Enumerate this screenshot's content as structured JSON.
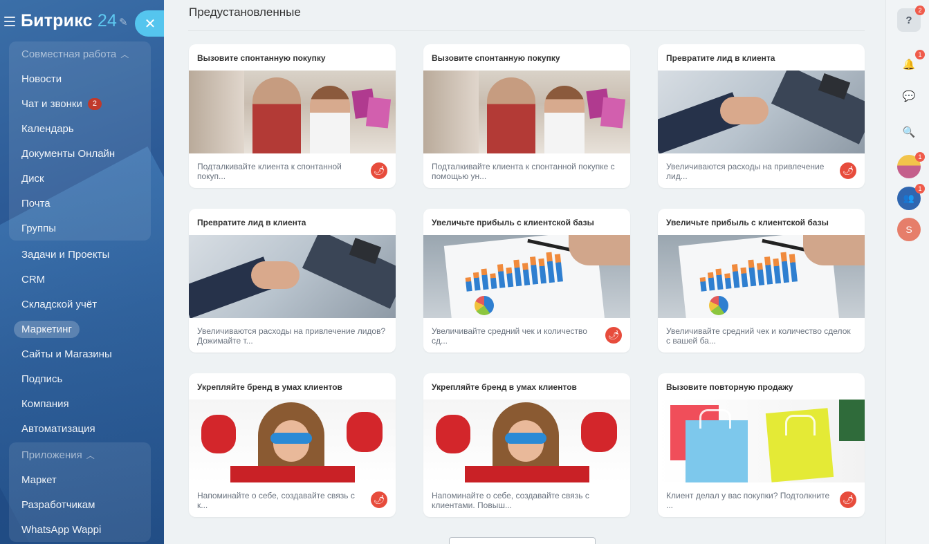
{
  "sidebar": {
    "logo_text": "Битрикс",
    "logo_num": "24",
    "groups": [
      {
        "title": "Совместная работа",
        "items": [
          {
            "label": "Новости"
          },
          {
            "label": "Чат и звонки",
            "badge": "2"
          },
          {
            "label": "Календарь"
          },
          {
            "label": "Документы Онлайн"
          },
          {
            "label": "Диск"
          },
          {
            "label": "Почта"
          },
          {
            "label": "Группы"
          }
        ]
      }
    ],
    "items": [
      {
        "label": "Задачи и Проекты"
      },
      {
        "label": "CRM"
      },
      {
        "label": "Складской учёт"
      },
      {
        "label": "Маркетинг",
        "active": true
      },
      {
        "label": "Сайты и Магазины"
      },
      {
        "label": "Подпись"
      },
      {
        "label": "Компания"
      },
      {
        "label": "Автоматизация"
      }
    ],
    "apps_group": {
      "title": "Приложения",
      "items": [
        {
          "label": "Маркет"
        },
        {
          "label": "Разработчикам"
        },
        {
          "label": "WhatsApp Wappi"
        }
      ]
    }
  },
  "main": {
    "section_title": "Предустановленные",
    "cards": [
      {
        "title": "Вызовите спонтанную покупку",
        "text": "Подталкивайте клиента к спонтанной покуп...",
        "image": "shopping-couple",
        "fire": true
      },
      {
        "title": "Вызовите спонтанную покупку",
        "text": "Подталкивайте клиента к спонтанной покупке с помощью ун...",
        "image": "shopping-couple",
        "fire": false
      },
      {
        "title": "Превратите лид в клиента",
        "text": "Увеличиваются расходы на привлечение лид...",
        "image": "handshake",
        "fire": true
      },
      {
        "title": "Превратите лид в клиента",
        "text": "Увеличиваются расходы на привлечение лидов? Дожимайте т...",
        "image": "handshake",
        "fire": false
      },
      {
        "title": "Увеличьте прибыль с клиентской базы",
        "text": "Увеличивайте средний чек и количество сд...",
        "image": "chart-paper",
        "fire": true
      },
      {
        "title": "Увеличьте прибыль с клиентской базы",
        "text": "Увеличивайте средний чек и количество сделок с вашей ба...",
        "image": "chart-paper",
        "fire": false
      },
      {
        "title": "Укрепляйте бренд в умах клиентов",
        "text": "Напоминайте о себе, создавайте связь с к...",
        "image": "superhero-kid",
        "fire": true
      },
      {
        "title": "Укрепляйте бренд в умах клиентов",
        "text": "Напоминайте о себе, создавайте связь с клиентами. Повыш...",
        "image": "superhero-kid",
        "fire": false
      },
      {
        "title": "Вызовите повторную продажу",
        "text": "Клиент делал у вас покупки? Подтолкните ...",
        "image": "shopping-bags",
        "fire": true
      }
    ]
  },
  "rail": {
    "help_badge": "2",
    "notify_badge": "1",
    "avatar1_badge": "1",
    "avatar2_badge": "1",
    "user_initial": "S"
  },
  "colors": {
    "accent": "#55c5ee",
    "fire": "#e74c3c",
    "badge": "#ef5b4b"
  }
}
